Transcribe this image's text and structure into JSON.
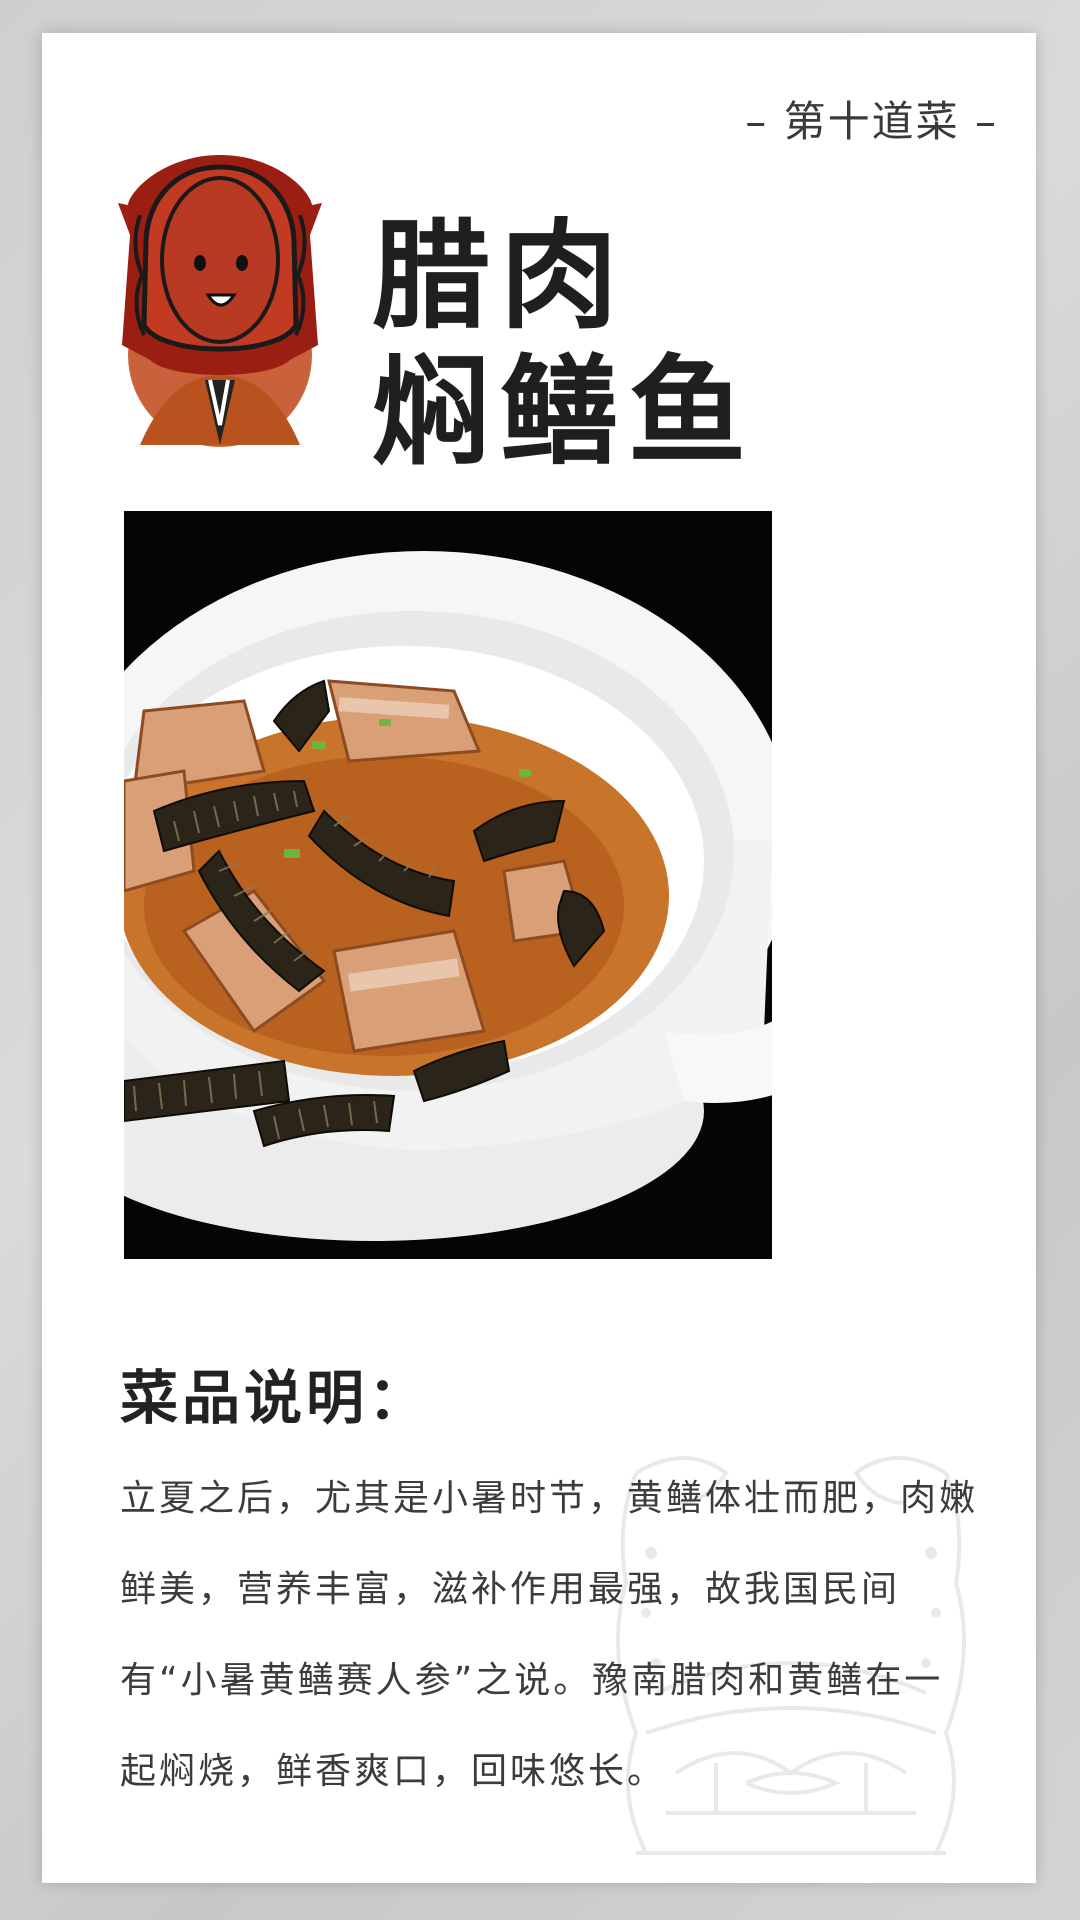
{
  "header": {
    "dish_number": "– 第十道菜 –"
  },
  "dish": {
    "title_line1": "腊肉",
    "title_line2": "焖鳝鱼"
  },
  "description": {
    "heading": "菜品说明：",
    "text": "立夏之后，尤其是小暑时节，黄鳝体壮而肥，肉嫩鲜美，营养丰富，滋补作用最强，故我国民间有“小暑黄鳝赛人参”之说。豫南腊肉和黄鳝在一起焖烧，鲜香爽口，回味悠长。"
  },
  "colors": {
    "mascot_red": "#b8321f",
    "mascot_face": "#b83a22",
    "mascot_circle": "#c9623a",
    "photo_background": "#050505",
    "bowl": "#f4f4f4",
    "broth": "#c8742a"
  },
  "icons": {
    "mascot": "mascot-icon",
    "watermark": "bronze-dragon-watermark-icon"
  }
}
